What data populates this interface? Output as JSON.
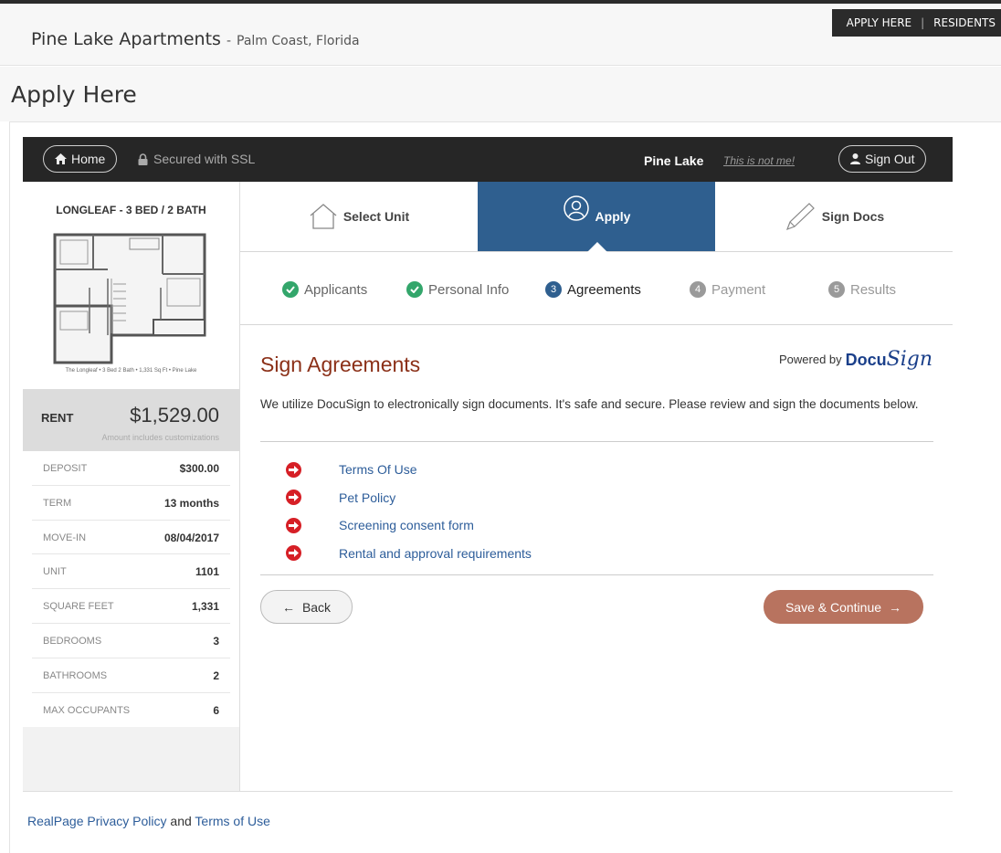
{
  "site": {
    "title": "Pine Lake Apartments",
    "separator": "-",
    "location": "Palm Coast, Florida",
    "links": [
      "APPLY HERE",
      "RESIDENTS"
    ],
    "link_separator": "|"
  },
  "page_title": "Apply Here",
  "navbar": {
    "home_label": "Home",
    "ssl_label": "Secured with SSL",
    "user_name": "Pine Lake",
    "not_me_label": "This is not me!",
    "sign_out_label": "Sign Out"
  },
  "sidebar": {
    "plan_title": "LONGLEAF - 3 BED / 2 BATH",
    "plan_caption": "The Longleaf • 3 Bed 2 Bath • 1,331 Sq Ft • Pine Lake",
    "rent_label": "RENT",
    "rent_value": "$1,529.00",
    "rent_note": "Amount includes customizations",
    "details": [
      {
        "label": "DEPOSIT",
        "value": "$300.00"
      },
      {
        "label": "TERM",
        "value": "13 months"
      },
      {
        "label": "MOVE-IN",
        "value": "08/04/2017"
      },
      {
        "label": "UNIT",
        "value": "1101"
      },
      {
        "label": "SQUARE FEET",
        "value": "1,331"
      },
      {
        "label": "BEDROOMS",
        "value": "3"
      },
      {
        "label": "BATHROOMS",
        "value": "2"
      },
      {
        "label": "MAX OCCUPANTS",
        "value": "6"
      }
    ]
  },
  "steps": [
    {
      "label": "Select Unit",
      "state": "inactive"
    },
    {
      "label": "Apply",
      "state": "active"
    },
    {
      "label": "Sign Docs",
      "state": "inactive"
    }
  ],
  "substeps": [
    {
      "label": "Applicants",
      "state": "done",
      "number": ""
    },
    {
      "label": "Personal Info",
      "state": "done",
      "number": ""
    },
    {
      "label": "Agreements",
      "state": "active",
      "number": "3"
    },
    {
      "label": "Payment",
      "state": "future",
      "number": "4"
    },
    {
      "label": "Results",
      "state": "future",
      "number": "5"
    }
  ],
  "content": {
    "title": "Sign Agreements",
    "powered_by": "Powered by",
    "docu_brand_a": "Docu",
    "docu_brand_b": "Sign",
    "description": "We utilize DocuSign to electronically sign documents. It's safe and secure. Please review and sign the documents below.",
    "documents": [
      "Terms Of Use",
      "Pet Policy",
      "Screening consent form",
      "Rental and approval requirements"
    ],
    "back_label": "Back",
    "save_label": "Save & Continue"
  },
  "footer": {
    "privacy_link": "RealPage Privacy Policy",
    "and_text": "and",
    "terms_link": "Terms of Use"
  },
  "colors": {
    "active_step": "#2f5f8f",
    "done_check": "#33a66b",
    "title_accent": "#8b3018",
    "doc_icon": "#d61f26",
    "save_button": "#b8735f",
    "link": "#2d5d9a"
  }
}
